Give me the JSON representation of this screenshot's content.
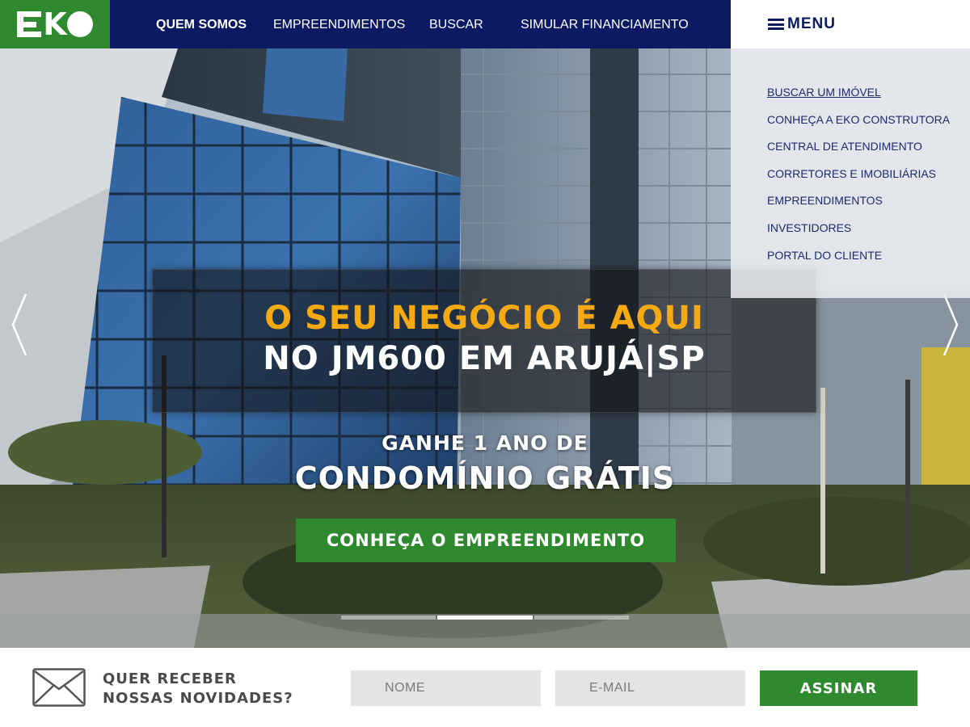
{
  "brand": {
    "logo_alt": "EKO",
    "green": "#2f8a2f",
    "navy": "#0b1a63",
    "orange": "#f5a912"
  },
  "nav": {
    "items": [
      "QUEM SOMOS",
      "EMPREENDIMENTOS",
      "BUSCAR",
      "SIMULAR FINANCIAMENTO"
    ],
    "active_index": 0
  },
  "menu": {
    "label": "MENU",
    "items": [
      "BUSCAR UM IMÓVEL",
      "CONHEÇA A EKO CONSTRUTORA",
      "CENTRAL DE ATENDIMENTO",
      "CORRETORES  E IMOBILIÁRIAS",
      "EMPREENDIMENTOS",
      "INVESTIDORES",
      "PORTAL DO CLIENTE"
    ]
  },
  "hero": {
    "headline": "O SEU NEGÓCIO É AQUI",
    "subheadline": "NO JM600 EM ARUJÁ|SP",
    "promo_line1": "GANHE 1 ANO DE",
    "promo_line2": "CONDOMÍNIO GRÁTIS",
    "cta_label": "CONHEÇA O EMPREENDIMENTO",
    "slide_count": 3,
    "active_slide": 1
  },
  "newsletter": {
    "title_line1": "QUER RECEBER",
    "title_line2": "NOSSAS NOVIDADES?",
    "name_placeholder": "NOME",
    "email_placeholder": "E-MAIL",
    "submit_label": "ASSINAR"
  }
}
